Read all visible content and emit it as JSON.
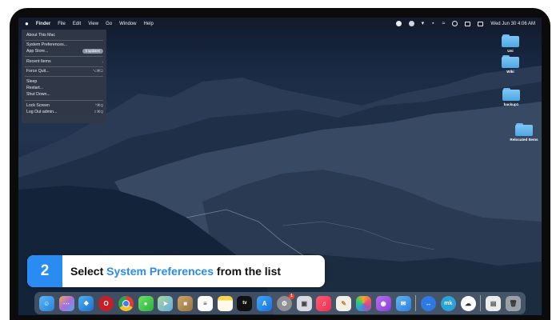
{
  "menubar": {
    "app": "Finder",
    "items": [
      "File",
      "Edit",
      "View",
      "Go",
      "Window",
      "Help"
    ],
    "clock": "Wed Jun 30  4:06 AM"
  },
  "apple_menu": {
    "about": "About This Mac",
    "system_prefs": "System Preferences...",
    "app_store": "App Store...",
    "app_store_badge": "5 updates",
    "recent": "Recent Items",
    "recent_arrow": "›",
    "force_quit": "Force Quit...",
    "force_quit_shortcut": "⌥⌘⎋",
    "sleep": "Sleep",
    "restart": "Restart...",
    "shutdown": "Shut Down...",
    "lock": "Lock Screen",
    "lock_shortcut": "^⌘Q",
    "logout": "Log Out admin...",
    "logout_shortcut": "⇧⌘Q"
  },
  "desktop_icons": [
    "Uni",
    "Wiki",
    "backup1",
    "Relocated Items"
  ],
  "caption": {
    "step": "2",
    "before": "Select ",
    "highlight": "System Preferences",
    "after": " from the list"
  },
  "dock": {
    "tv_label": "tv",
    "sysprefs_badge": "1"
  },
  "colors": {
    "accent": "#2a8bf2",
    "folder": "#5fb2ea"
  }
}
